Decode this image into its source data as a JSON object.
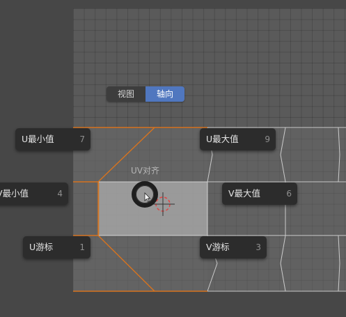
{
  "view_toggle": {
    "options": [
      "视图",
      "轴向"
    ],
    "selected": "轴向"
  },
  "pie_menu": {
    "title": "UV对齐",
    "items": {
      "u_min": {
        "label": "U最小值",
        "key": "7"
      },
      "u_max": {
        "label": "U最大值",
        "key": "9"
      },
      "v_min": {
        "label": "V最小值",
        "key": "4"
      },
      "v_max": {
        "label": "V最大值",
        "key": "6"
      },
      "u_cursor": {
        "label": "U游标",
        "key": "1"
      },
      "v_cursor": {
        "label": "V游标",
        "key": "3"
      }
    }
  },
  "colors": {
    "selected_edge": "#d8731e",
    "toggle_active": "#5077bf",
    "face_selected": "#a8a8a8"
  },
  "icons": {
    "pie_center": "pie-center-ring-icon",
    "mouse_pointer": "mouse-pointer-icon",
    "cursor_2d": "2d-cursor-crosshair-icon"
  }
}
